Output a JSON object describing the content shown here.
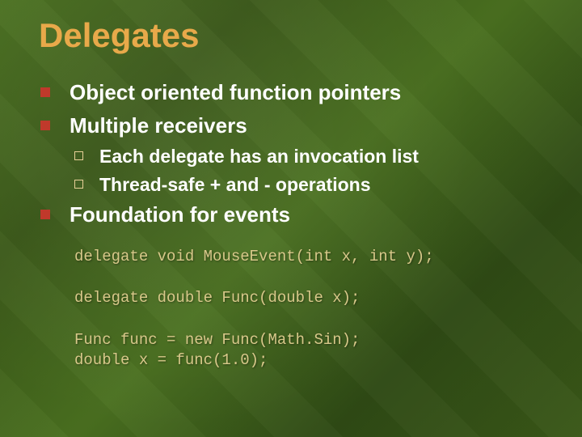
{
  "title": "Delegates",
  "bullets": {
    "b1": "Object oriented function pointers",
    "b2": "Multiple receivers",
    "b2a": "Each delegate has an invocation list",
    "b2b": "Thread-safe + and - operations",
    "b3": "Foundation for events"
  },
  "code": "delegate void MouseEvent(int x, int y);\n\ndelegate double Func(double x);\n\nFunc func = new Func(Math.Sin);\ndouble x = func(1.0);"
}
